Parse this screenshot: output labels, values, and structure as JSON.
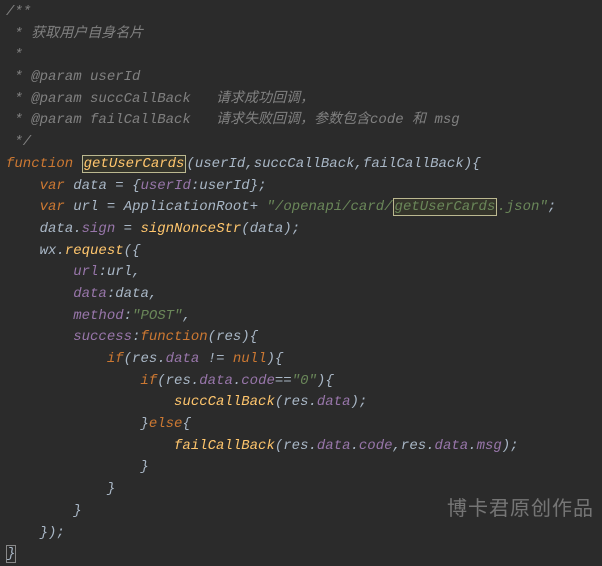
{
  "comment": {
    "l1": "/**",
    "l2": " * 获取用户自身名片",
    "l3": " *",
    "l4": " * @param userId",
    "l5": " * @param succCallBack   请求成功回调，",
    "l6": " * @param failCallBack   请求失败回调，参数包含code 和 msg",
    "l7": " */"
  },
  "kw": {
    "function": "function",
    "var": "var",
    "if": "if",
    "else": "else",
    "null": "null"
  },
  "fn": {
    "getUserCards": "getUserCards",
    "signNonceStr": "signNonceStr",
    "request": "request",
    "succCallBack": "succCallBack",
    "failCallBack": "failCallBack"
  },
  "id": {
    "userId": "userId",
    "succCallBack": "succCallBack",
    "failCallBack": "failCallBack",
    "data": "data",
    "url": "url",
    "ApplicationRoot": "ApplicationRoot",
    "wx": "wx",
    "res": "res"
  },
  "prop": {
    "sign": "sign",
    "url": "url",
    "data": "data",
    "method": "method",
    "success": "success",
    "code": "code",
    "msg": "msg",
    "userId": "userId"
  },
  "str": {
    "path1": "\"/openapi/card/",
    "getUserCards": "getUserCards",
    "path2": ".json\"",
    "post": "\"POST\"",
    "zero": "\"0\""
  },
  "watermark": "博卡君原创作品"
}
